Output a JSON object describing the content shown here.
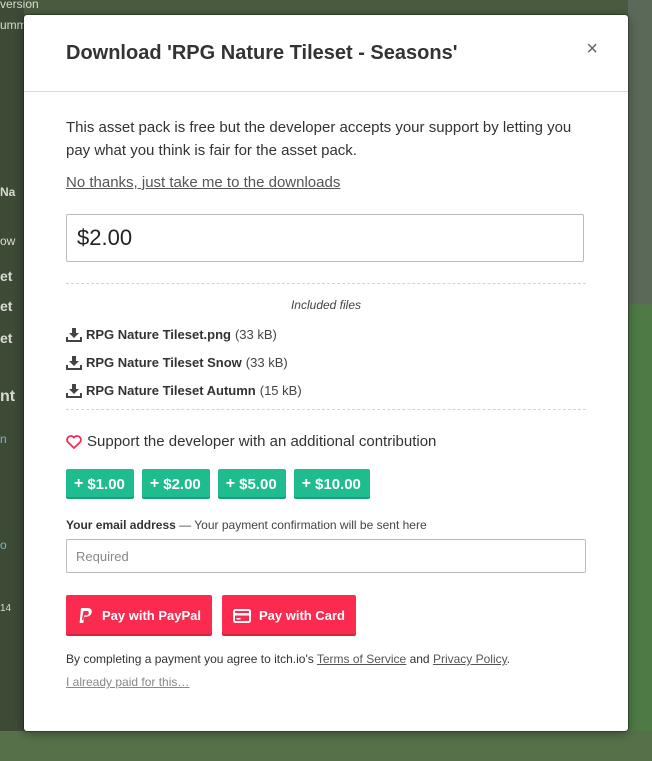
{
  "background": {
    "left_fragments": [
      "version",
      "umm",
      "Na",
      "ow",
      "et",
      "et",
      "et",
      "nt",
      "n",
      "o",
      "14"
    ]
  },
  "modal": {
    "title": "Download 'RPG Nature Tileset - Seasons'",
    "close_glyph": "×",
    "intro": "This asset pack is free but the developer accepts your support by letting you pay what you think is fair for the asset pack.",
    "no_thanks": "No thanks, just take me to the downloads",
    "price_value": "$2.00",
    "included_files_title": "Included files",
    "files": [
      {
        "name": "RPG Nature Tileset.png",
        "size": "(33 kB)"
      },
      {
        "name": "RPG Nature Tileset Snow",
        "size": "(33 kB)"
      },
      {
        "name": "RPG Nature Tileset Autumn",
        "size": "(15 kB)"
      }
    ],
    "support_text": "Support the developer with an additional contribution",
    "tips": [
      "$1.00",
      "$2.00",
      "$5.00",
      "$10.00"
    ],
    "email_label_bold": "Your email address",
    "email_label_rest": " — Your payment confirmation will be sent here",
    "email_placeholder": "Required",
    "paypal_label": "Pay with PayPal",
    "card_label": "Pay with Card",
    "terms_prefix": "By completing a payment you agree to itch.io's ",
    "terms_link": "Terms of Service",
    "terms_and": " and ",
    "privacy_link": "Privacy Policy",
    "terms_suffix": ".",
    "already_paid": "I already paid for this…"
  },
  "colors": {
    "accent_green": "#1ebc8f",
    "accent_red": "#fa2b4e"
  }
}
